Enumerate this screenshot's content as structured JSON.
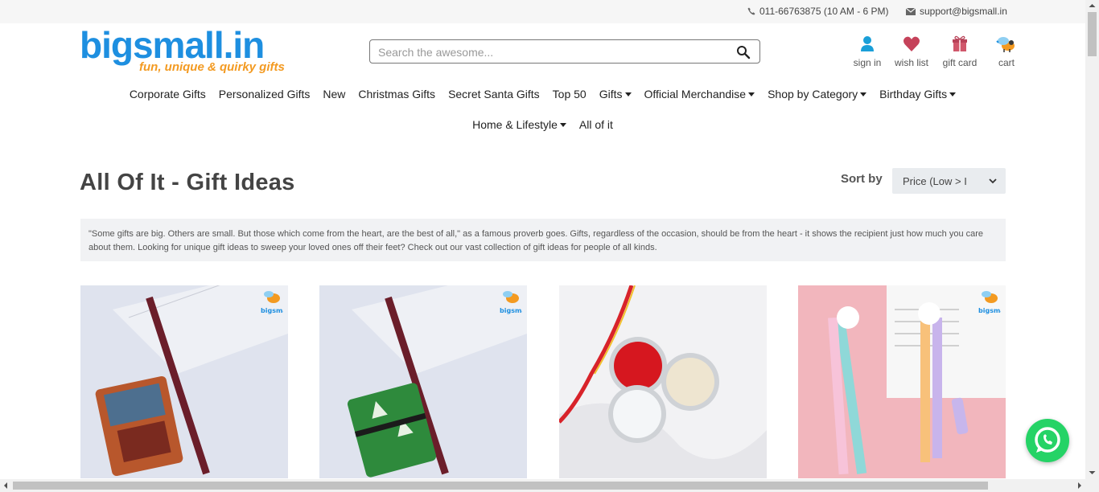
{
  "topbar": {
    "phone": "011-66763875 (10 AM - 6 PM)",
    "email": "support@bigsmall.in"
  },
  "logo": {
    "brand": "bigsmall.in",
    "tagline": "fun, unique & quirky gifts"
  },
  "search": {
    "placeholder": "Search the awesome..."
  },
  "header_icons": {
    "signin": "sign in",
    "wishlist": "wish list",
    "giftcard": "gift card",
    "cart": "cart"
  },
  "nav": {
    "row1": [
      "Corporate Gifts",
      "Personalized Gifts",
      "New",
      "Christmas Gifts",
      "Secret Santa Gifts",
      "Top 50",
      "Gifts",
      "Official Merchandise",
      "Shop by Category",
      "Birthday Gifts"
    ],
    "row2": [
      "Home & Lifestyle",
      "All of it"
    ]
  },
  "page": {
    "title": "All Of It - Gift Ideas",
    "sort_label": "Sort by",
    "sort_value": "Price (Low > I",
    "intro": "\"Some gifts are big. Others are small. But those which come from the heart, are the best of all,\" as a famous proverb goes. Gifts, regardless of the occasion, should be from the heart - it shows the recipient just how much you care about them. Looking for unique gift ideas to sweep your loved ones off their feet? Check out our vast collection of gift ideas for people of all kinds."
  },
  "products": [
    {
      "image": "diary-and-pencil-brown"
    },
    {
      "image": "diary-and-pencil-green"
    },
    {
      "image": "roli-chawal-tins"
    },
    {
      "image": "unicorn-pens"
    }
  ],
  "colors": {
    "brand_blue": "#1e8fe0",
    "brand_orange": "#f39a21",
    "whatsapp": "#25d366"
  }
}
